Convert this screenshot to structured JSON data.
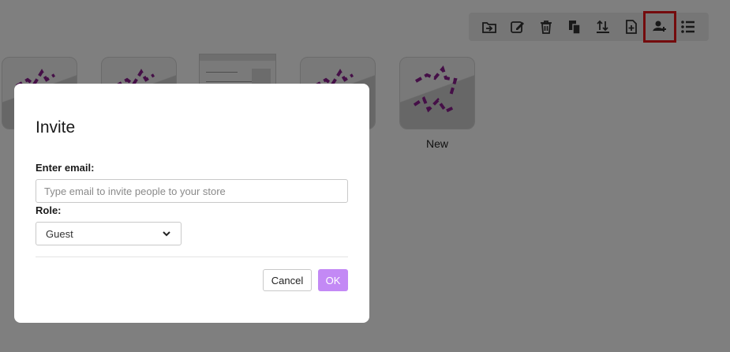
{
  "toolbar": {
    "buttons": [
      {
        "icon": "move-to-folder-icon"
      },
      {
        "icon": "edit-icon"
      },
      {
        "icon": "delete-icon"
      },
      {
        "icon": "copy-icon"
      },
      {
        "icon": "sort-icon"
      },
      {
        "icon": "new-file-icon"
      },
      {
        "icon": "invite-user-icon",
        "highlighted": true
      },
      {
        "icon": "list-view-icon"
      }
    ],
    "highlight_color": "#e8161b"
  },
  "tiles": [
    {
      "label": ""
    },
    {
      "label": ""
    },
    {
      "label": ""
    },
    {
      "label": ""
    },
    {
      "label": "New"
    }
  ],
  "modal": {
    "title": "Invite",
    "email_label": "Enter email:",
    "email_placeholder": "Type email to invite people to your store",
    "email_value": "",
    "role_label": "Role:",
    "role_selected": "Guest",
    "cancel_label": "Cancel",
    "ok_label": "OK"
  },
  "colors": {
    "accent": "#c389f5",
    "overlay": "rgba(0,0,0,0.5)",
    "art": "#8a1f8f"
  }
}
